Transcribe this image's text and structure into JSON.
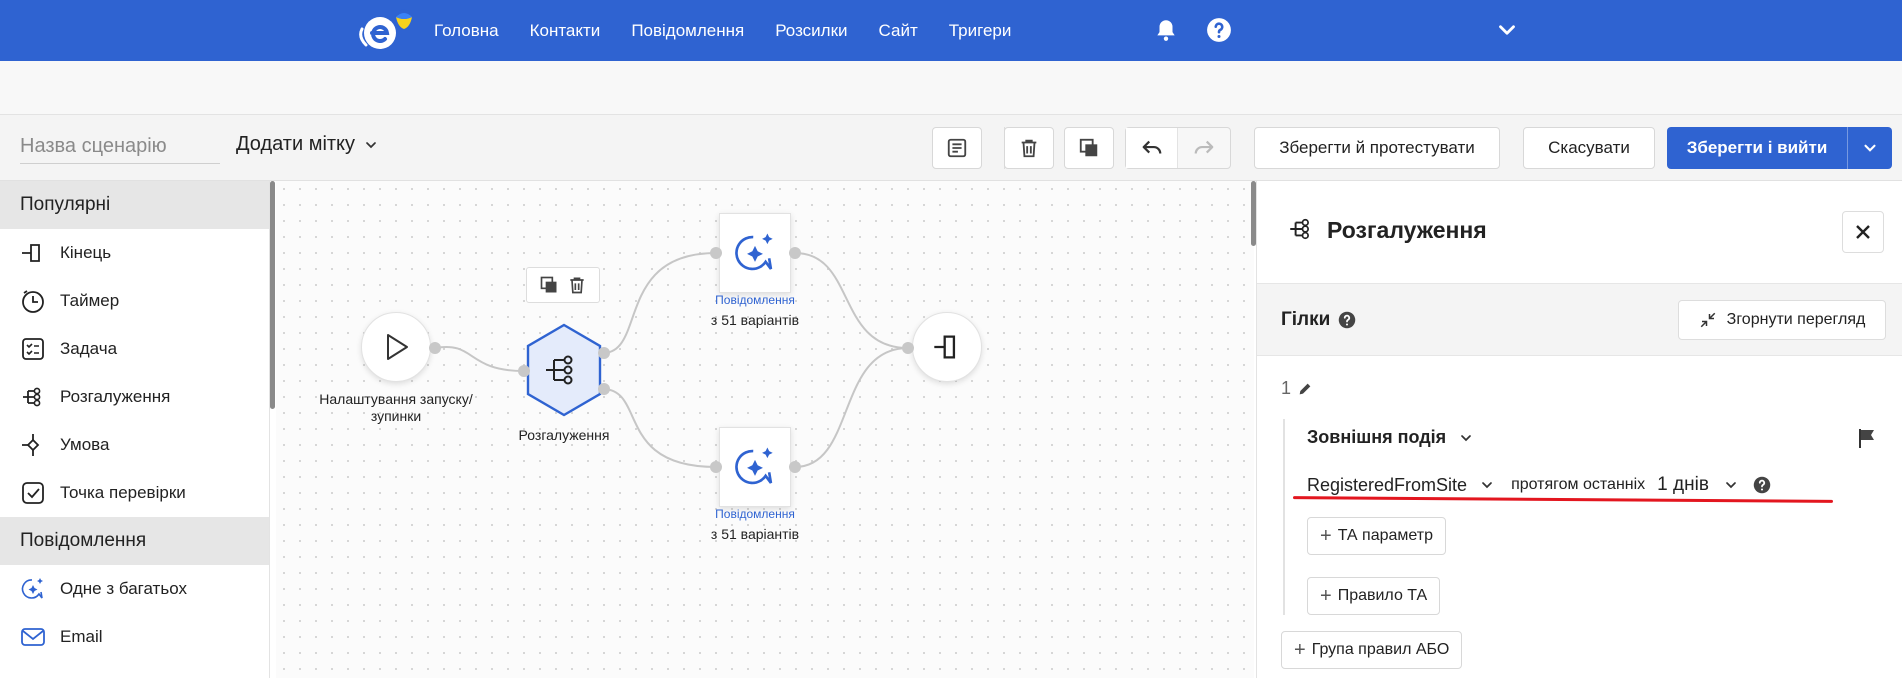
{
  "nav": {
    "items": [
      "Головна",
      "Контакти",
      "Повідомлення",
      "Розсилки",
      "Сайт",
      "Тригери"
    ]
  },
  "toolbar": {
    "scenario_placeholder": "Назва сценарію",
    "tag_label": "Додати мітку",
    "save_test_label": "Зберегти й протестувати",
    "cancel_label": "Скасувати",
    "save_exit_label": "Зберегти і вийти"
  },
  "sidebar": {
    "sections": [
      {
        "title": "Популярні",
        "items": [
          {
            "label": "Кінець",
            "icon": "end-icon"
          },
          {
            "label": "Таймер",
            "icon": "timer-icon"
          },
          {
            "label": "Задача",
            "icon": "task-icon"
          },
          {
            "label": "Розгалуження",
            "icon": "split-icon"
          },
          {
            "label": "Умова",
            "icon": "condition-icon"
          },
          {
            "label": "Точка перевірки",
            "icon": "checkpoint-icon"
          }
        ]
      },
      {
        "title": "Повідомлення",
        "items": [
          {
            "label": "Одне з багатьох",
            "icon": "ai-message-icon"
          },
          {
            "label": "Email",
            "icon": "email-icon"
          }
        ]
      }
    ]
  },
  "canvas": {
    "start_node_label": "Налаштування запуску/зупинки",
    "split_node_label": "Розгалуження",
    "message_top": {
      "type": "Повідомлення",
      "variants": "з 51 варіантів"
    },
    "message_bottom": {
      "type": "Повідомлення",
      "variants": "з 51 варіантів"
    }
  },
  "panel": {
    "title": "Розгалуження",
    "branches_label": "Гілки",
    "collapse_label": "Згорнути перегляд",
    "branch_number": "1",
    "event_type": "Зовнішня подія",
    "event_name": "RegisteredFromSite",
    "period_prefix": "протягом останніх",
    "period_value": "1 днів",
    "add_param_label": "ТА параметр",
    "add_rule_label": "Правило ТА",
    "add_group_label": "Група правил АБО"
  },
  "colors": {
    "brand": "#2f63d1",
    "highlight": "#e3161f",
    "flag_ukraine": [
      "#2f63d1",
      "#f7d21c"
    ]
  }
}
